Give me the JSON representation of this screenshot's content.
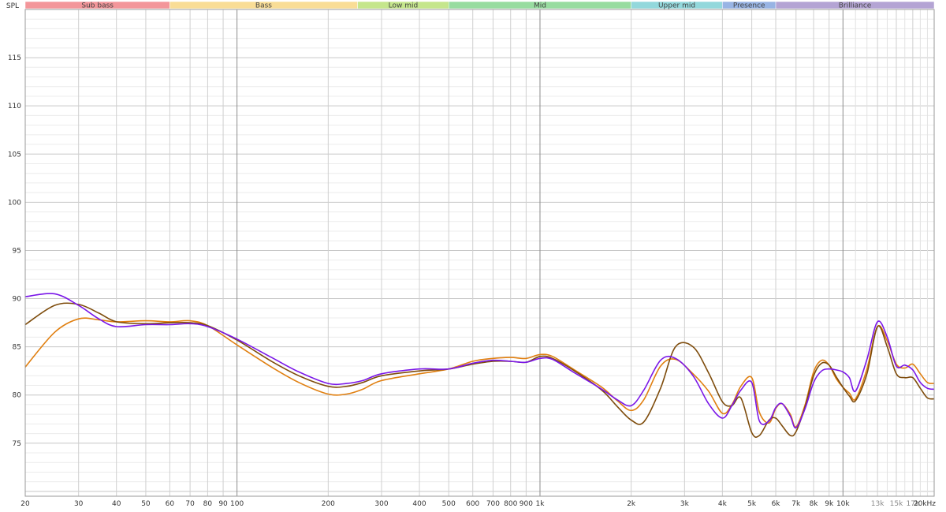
{
  "chart_data": {
    "type": "line",
    "ylabel": "SPL",
    "x_scale": "log",
    "xlim": [
      20,
      20000
    ],
    "ylim": [
      69.5,
      120
    ],
    "grid": true,
    "y_ticks": [
      75,
      80,
      85,
      90,
      95,
      100,
      105,
      110,
      115
    ],
    "x_ticks": [
      {
        "value": 20,
        "label": "20"
      },
      {
        "value": 30,
        "label": "30"
      },
      {
        "value": 40,
        "label": "40"
      },
      {
        "value": 50,
        "label": "50"
      },
      {
        "value": 60,
        "label": "60"
      },
      {
        "value": 70,
        "label": "70"
      },
      {
        "value": 80,
        "label": "80"
      },
      {
        "value": 90,
        "label": "90"
      },
      {
        "value": 100,
        "label": "100"
      },
      {
        "value": 200,
        "label": "200"
      },
      {
        "value": 300,
        "label": "300"
      },
      {
        "value": 400,
        "label": "400"
      },
      {
        "value": 500,
        "label": "500"
      },
      {
        "value": 600,
        "label": "600"
      },
      {
        "value": 700,
        "label": "700"
      },
      {
        "value": 800,
        "label": "800"
      },
      {
        "value": 900,
        "label": "900"
      },
      {
        "value": 1000,
        "label": "1k"
      },
      {
        "value": 2000,
        "label": "2k"
      },
      {
        "value": 3000,
        "label": "3k"
      },
      {
        "value": 4000,
        "label": "4k"
      },
      {
        "value": 5000,
        "label": "5k"
      },
      {
        "value": 6000,
        "label": "6k"
      },
      {
        "value": 7000,
        "label": "7k"
      },
      {
        "value": 8000,
        "label": "8k"
      },
      {
        "value": 9000,
        "label": "9k"
      },
      {
        "value": 10000,
        "label": "10k"
      },
      {
        "value": 13000,
        "label": "13k",
        "minor": true
      },
      {
        "value": 15000,
        "label": "15k",
        "minor": true
      },
      {
        "value": 17000,
        "label": "17k",
        "minor": true
      },
      {
        "value": 20000,
        "label": "20kHz"
      }
    ],
    "bands": [
      {
        "label": "Sub bass",
        "from": 20,
        "to": 60,
        "color": "#f3969a"
      },
      {
        "label": "Bass",
        "from": 60,
        "to": 250,
        "color": "#f9dd96"
      },
      {
        "label": "Low mid",
        "from": 250,
        "to": 500,
        "color": "#c5e68c"
      },
      {
        "label": "Mid",
        "from": 500,
        "to": 2000,
        "color": "#98dca0"
      },
      {
        "label": "Upper mid",
        "from": 2000,
        "to": 4000,
        "color": "#93d8dc"
      },
      {
        "label": "Presence",
        "from": 4000,
        "to": 6000,
        "color": "#98b4e4"
      },
      {
        "label": "Brilliance",
        "from": 6000,
        "to": 20000,
        "color": "#b4a4d4"
      }
    ],
    "series": [
      {
        "color": "#e07f10",
        "x": [
          20,
          25,
          30,
          35,
          40,
          50,
          60,
          70,
          80,
          100,
          130,
          160,
          200,
          230,
          260,
          300,
          400,
          500,
          600,
          700,
          800,
          900,
          1000,
          1100,
          1300,
          1600,
          1800,
          2000,
          2200,
          2500,
          2800,
          3200,
          3600,
          4000,
          4300,
          4600,
          5000,
          5300,
          5700,
          6000,
          6300,
          6700,
          7000,
          7500,
          8000,
          8500,
          9000,
          9500,
          10000,
          10500,
          11000,
          12000,
          13000,
          14000,
          15000,
          16000,
          17000,
          18000,
          19000,
          20000
        ],
        "y": [
          82.9,
          86.5,
          87.9,
          87.8,
          87.6,
          87.7,
          87.6,
          87.7,
          87.2,
          85.2,
          82.9,
          81.3,
          80.1,
          80.1,
          80.6,
          81.5,
          82.2,
          82.7,
          83.5,
          83.8,
          83.9,
          83.8,
          84.2,
          84.0,
          82.6,
          80.8,
          79.4,
          78.4,
          79.5,
          83.0,
          83.7,
          82.2,
          80.4,
          78.1,
          79.0,
          80.9,
          81.8,
          78.2,
          77.1,
          78.6,
          79.1,
          78.0,
          76.7,
          79.0,
          82.4,
          83.6,
          83.1,
          81.7,
          80.8,
          80.2,
          79.6,
          82.7,
          87.1,
          85.6,
          83.2,
          82.8,
          83.2,
          82.2,
          81.3,
          81.2
        ]
      },
      {
        "color": "#7e4c0c",
        "x": [
          20,
          25,
          30,
          35,
          40,
          50,
          60,
          70,
          80,
          100,
          130,
          160,
          200,
          230,
          260,
          300,
          400,
          500,
          600,
          700,
          800,
          900,
          1000,
          1100,
          1300,
          1600,
          1800,
          2000,
          2200,
          2500,
          2800,
          3200,
          3600,
          4000,
          4300,
          4600,
          5000,
          5300,
          5700,
          6000,
          6300,
          6700,
          7000,
          7500,
          8000,
          8500,
          9000,
          9500,
          10000,
          10500,
          11000,
          12000,
          13000,
          14000,
          15000,
          16000,
          17000,
          18000,
          19000,
          20000
        ],
        "y": [
          87.3,
          89.3,
          89.4,
          88.5,
          87.6,
          87.4,
          87.5,
          87.5,
          87.2,
          85.7,
          83.5,
          82.0,
          80.9,
          80.9,
          81.3,
          82.0,
          82.5,
          82.7,
          83.2,
          83.5,
          83.5,
          83.4,
          84.0,
          83.8,
          82.5,
          80.5,
          78.8,
          77.4,
          77.2,
          80.7,
          85.0,
          85.0,
          82.3,
          79.3,
          78.9,
          79.7,
          76.1,
          75.8,
          77.4,
          77.6,
          76.8,
          75.8,
          76.2,
          78.8,
          82.0,
          83.3,
          83.1,
          81.9,
          80.8,
          79.9,
          79.4,
          82.2,
          87.1,
          85.0,
          82.2,
          81.8,
          81.8,
          80.7,
          79.7,
          79.6
        ]
      },
      {
        "color": "#7a16e8",
        "x": [
          20,
          25,
          30,
          35,
          40,
          50,
          60,
          70,
          80,
          100,
          130,
          160,
          200,
          230,
          260,
          300,
          400,
          500,
          600,
          700,
          800,
          900,
          1000,
          1100,
          1300,
          1600,
          1800,
          2000,
          2200,
          2500,
          2800,
          3200,
          3600,
          4000,
          4300,
          4600,
          5000,
          5300,
          5700,
          6000,
          6300,
          6700,
          7000,
          7500,
          8000,
          8500,
          9000,
          9500,
          10000,
          10500,
          11000,
          12000,
          13000,
          14000,
          15000,
          16000,
          17000,
          18000,
          19000,
          20000
        ],
        "y": [
          90.2,
          90.5,
          89.3,
          87.9,
          87.1,
          87.3,
          87.3,
          87.4,
          87.1,
          85.8,
          83.9,
          82.4,
          81.2,
          81.2,
          81.5,
          82.2,
          82.7,
          82.7,
          83.3,
          83.6,
          83.5,
          83.4,
          83.8,
          83.7,
          82.3,
          80.6,
          79.5,
          78.9,
          80.5,
          83.6,
          83.8,
          82.0,
          79.1,
          77.6,
          78.9,
          80.5,
          81.3,
          77.3,
          77.3,
          78.7,
          79.1,
          77.8,
          76.6,
          78.6,
          81.3,
          82.5,
          82.7,
          82.6,
          82.4,
          81.8,
          80.4,
          83.7,
          87.6,
          86.0,
          83.0,
          83.1,
          82.6,
          81.3,
          80.7,
          80.6
        ]
      }
    ]
  }
}
